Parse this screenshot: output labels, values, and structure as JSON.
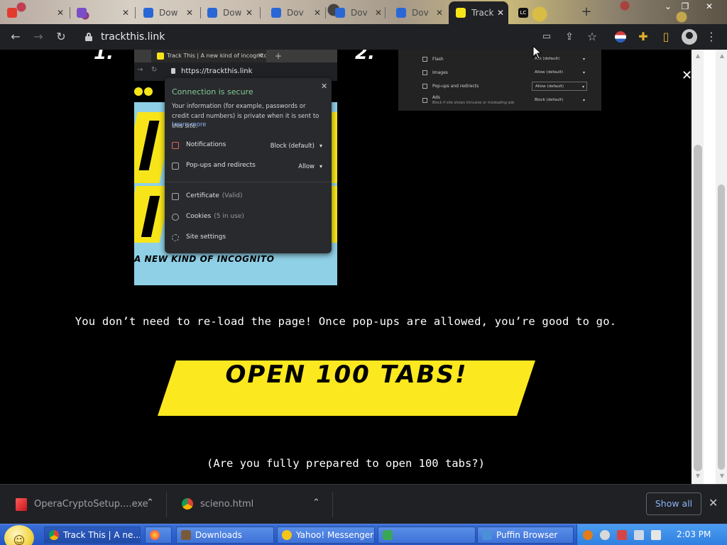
{
  "tabs": [
    {
      "label": "",
      "favicon_color": "#e23b2e"
    },
    {
      "label": "",
      "favicon_color": "#7a4ec9"
    },
    {
      "label": "Dow",
      "favicon_color": "#2a67d6"
    },
    {
      "label": "Dow",
      "favicon_color": "#2a67d6"
    },
    {
      "label": "Dov",
      "favicon_color": "#2a67d6"
    },
    {
      "label": "Dov",
      "favicon_color": "#2a67d6"
    },
    {
      "label": "Dov",
      "favicon_color": "#2a67d6"
    },
    {
      "label": "Track",
      "favicon_color": "#f7e51a",
      "active": true
    },
    {
      "label": "LC",
      "favicon_color": "#111111"
    }
  ],
  "address": {
    "url": "trackthis.link"
  },
  "steps": {
    "step1": "1.",
    "step2": "2."
  },
  "shot1": {
    "tab_title": "Track This | A new kind of incognito",
    "url": "https://trackthis.link",
    "popup": {
      "title": "Connection is secure",
      "description": "Your information (for example, passwords or credit card numbers) is private when it is sent to this site.",
      "learn_more": "Learn more",
      "notifications_label": "Notifications",
      "notifications_value": "Block (default)",
      "popups_label": "Pop-ups and redirects",
      "popups_value": "Allow",
      "certificate_label": "Certificate",
      "certificate_sub": "(Valid)",
      "cookies_label": "Cookies",
      "cookies_sub": "(5 in use)",
      "site_settings_label": "Site settings"
    },
    "banner": "A NEW KIND OF INCOGNITO"
  },
  "shot2": {
    "rows": [
      {
        "label": "Flash",
        "value": "Ask (default)"
      },
      {
        "label": "Images",
        "value": "Allow (default)"
      },
      {
        "label": "Pop-ups and redirects",
        "value": "Allow (default)",
        "highlight": true
      },
      {
        "label": "Ads",
        "sub": "Block if site shows intrusive or misleading ads",
        "value": "Block (default)"
      }
    ]
  },
  "page": {
    "note": "You don’t need to re-load the page! Once pop-ups are allowed, you’re good to go.",
    "cta": "OPEN 100 TABS!",
    "question": "(Are you fully prepared to open 100 tabs?)"
  },
  "downloads": {
    "items": [
      {
        "name": "OperaCryptoSetup....exe",
        "icon_color": "#e3262f"
      },
      {
        "name": "scieno.html",
        "icon_color": "#4285f4"
      }
    ],
    "show_all": "Show all"
  },
  "taskbar": {
    "items": [
      {
        "label": "Track This | A ne...",
        "icon_color": "#4285f4",
        "active": true
      },
      {
        "label": "",
        "icon_color": "#ff7139"
      },
      {
        "label": "Downloads",
        "icon_color": "#7a5a3a"
      },
      {
        "label": "Yahoo! Messenger",
        "icon_color": "#f5c518"
      },
      {
        "label": "",
        "icon_color": "#3aa757"
      },
      {
        "label": "Puffin Browser",
        "icon_color": "#4a90d9"
      }
    ],
    "clock": "2:03 PM"
  },
  "colors": {
    "accent_yellow": "#fbe81f",
    "chrome_dark": "#202124",
    "link_blue": "#8ab4f8",
    "secure_green": "#81c995"
  }
}
